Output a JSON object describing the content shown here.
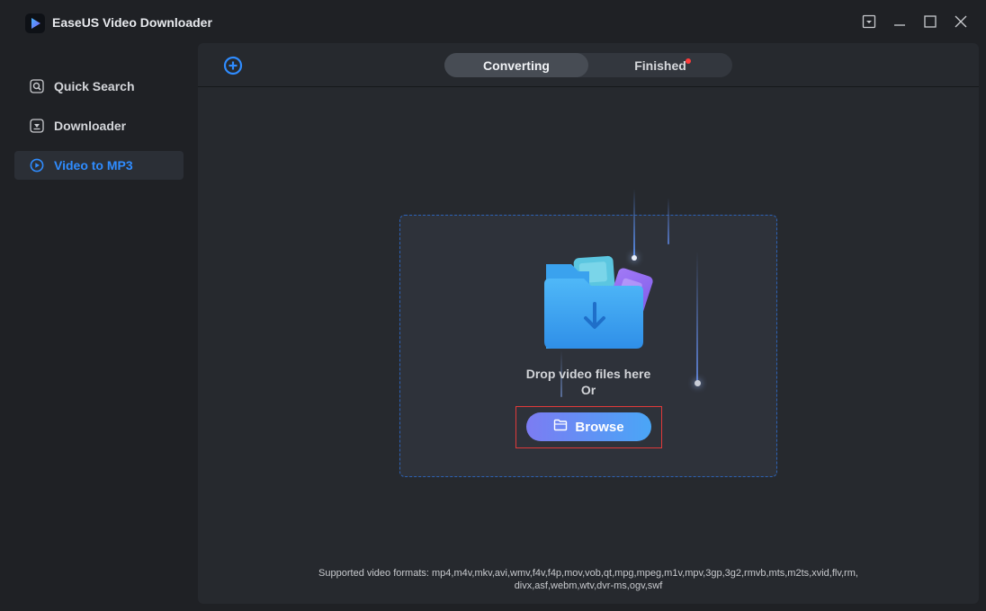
{
  "app": {
    "title": "EaseUS Video Downloader"
  },
  "window_controls": {
    "menu_icon": "dropdown-menu-icon",
    "minimize_icon": "minimize-icon",
    "maximize_icon": "maximize-icon",
    "close_icon": "close-icon"
  },
  "sidebar": {
    "items": [
      {
        "label": "Quick Search",
        "icon": "search-icon",
        "active": false
      },
      {
        "label": "Downloader",
        "icon": "download-icon",
        "active": false
      },
      {
        "label": "Video to MP3",
        "icon": "video-convert-icon",
        "active": true
      }
    ]
  },
  "header": {
    "add_icon": "add-circle-icon",
    "tabs": [
      {
        "label": "Converting",
        "active": true
      },
      {
        "label": "Finished",
        "active": false,
        "has_notification": true
      }
    ]
  },
  "dropzone": {
    "line1": "Drop video files here",
    "line2": "Or",
    "browse_label": "Browse",
    "browse_icon": "folder-open-icon"
  },
  "footer": {
    "formats_line1": "Supported video formats: mp4,m4v,mkv,avi,wmv,f4v,f4p,mov,vob,qt,mpg,mpeg,m1v,mpv,3gp,3g2,rmvb,mts,m2ts,xvid,flv,rm,",
    "formats_line2": "divx,asf,webm,wtv,dvr-ms,ogv,swf"
  },
  "colors": {
    "accent": "#2f8cff",
    "highlight_box": "#e03a3a",
    "notify": "#ff3b3b"
  }
}
